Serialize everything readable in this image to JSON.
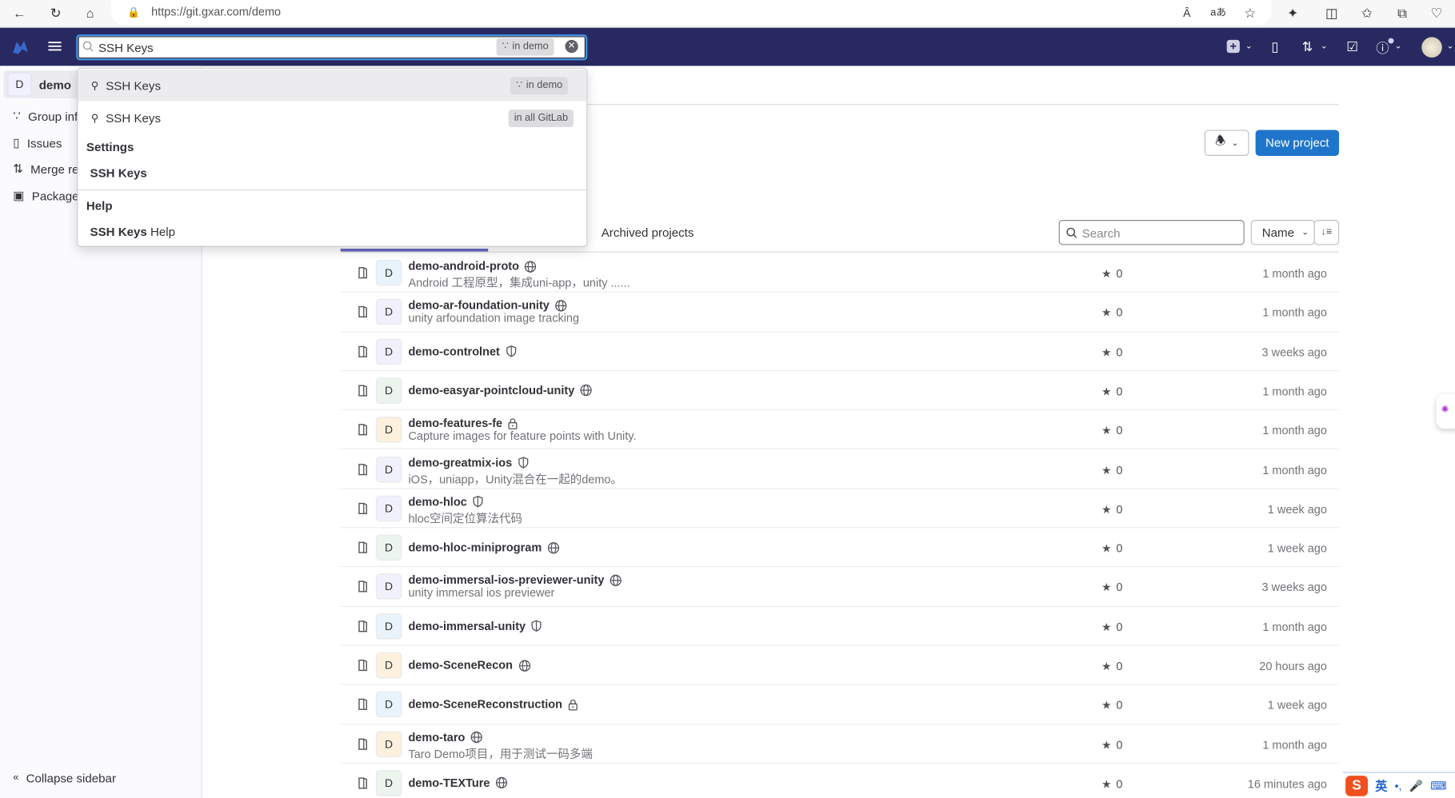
{
  "browser": {
    "url": "https://git.gxar.com/demo",
    "icons": [
      "back-icon",
      "refresh-icon",
      "home-icon",
      "lock-icon",
      "read-aloud-icon",
      "translate-icon",
      "favorite-star-icon",
      "extensions-icon",
      "split-screen-icon",
      "favorites-icon",
      "collections-icon",
      "browser-essentials-icon"
    ]
  },
  "nav": {
    "search_value": "SSH Keys",
    "search_scope": "in demo",
    "colors": {
      "nav_bg": "#292961",
      "primary": "#1f75cb",
      "focus": "#428fdc"
    }
  },
  "dropdown": {
    "items": [
      {
        "label": "SSH Keys",
        "scope": "in demo"
      },
      {
        "label": "SSH Keys",
        "scope": "in all GitLab"
      }
    ],
    "settings_header": "Settings",
    "settings_item": "SSH Keys",
    "help_header": "Help",
    "help_item_bold": "SSH Keys",
    "help_item_rest": " Help"
  },
  "sidebar": {
    "group_avatar": "D",
    "group_name": "demo",
    "items": [
      {
        "label": "Group information",
        "icon": "group-icon"
      },
      {
        "label": "Issues",
        "icon": "issues-icon"
      },
      {
        "label": "Merge requests",
        "icon": "merge-request-icon"
      },
      {
        "label": "Packages and registries",
        "icon": "package-icon"
      }
    ],
    "collapse": "Collapse sidebar"
  },
  "main": {
    "new_project": "New project",
    "tabs": [
      {
        "label": "",
        "active": true
      },
      {
        "label": "Archived projects",
        "active": false
      }
    ],
    "search_placeholder": "Search",
    "sort_label": "Name",
    "projects": [
      {
        "name": "demo-android-proto",
        "visibility": "public",
        "desc": "Android 工程原型，集成uni-app，unity ......",
        "avatar": "D",
        "color": "#e9f3fc",
        "stars": "0",
        "updated": "1 month ago"
      },
      {
        "name": "demo-ar-foundation-unity",
        "visibility": "public",
        "desc": "unity arfoundation image tracking",
        "avatar": "D",
        "color": "#f1f0fd",
        "stars": "0",
        "updated": "1 month ago"
      },
      {
        "name": "demo-controlnet",
        "visibility": "internal",
        "desc": "",
        "avatar": "D",
        "color": "#f1f0fd",
        "stars": "0",
        "updated": "3 weeks ago"
      },
      {
        "name": "demo-easyar-pointcloud-unity",
        "visibility": "public",
        "desc": "",
        "avatar": "D",
        "color": "#ecf4ee",
        "stars": "0",
        "updated": "1 month ago"
      },
      {
        "name": "demo-features-fe",
        "visibility": "private",
        "desc": "Capture images for feature points with Unity.",
        "avatar": "D",
        "color": "#fdf1dd",
        "stars": "0",
        "updated": "1 month ago"
      },
      {
        "name": "demo-greatmix-ios",
        "visibility": "internal",
        "desc": "iOS，uniapp，Unity混合在一起的demo。",
        "avatar": "D",
        "color": "#f1f0fd",
        "stars": "0",
        "updated": "1 month ago"
      },
      {
        "name": "demo-hloc",
        "visibility": "internal",
        "desc": "hloc空间定位算法代码",
        "avatar": "D",
        "color": "#f1f0fd",
        "stars": "0",
        "updated": "1 week ago"
      },
      {
        "name": "demo-hloc-miniprogram",
        "visibility": "public",
        "desc": "",
        "avatar": "D",
        "color": "#ecf4ee",
        "stars": "0",
        "updated": "1 week ago"
      },
      {
        "name": "demo-immersal-ios-previewer-unity",
        "visibility": "public",
        "desc": "unity immersal ios previewer",
        "avatar": "D",
        "color": "#f1f0fd",
        "stars": "0",
        "updated": "3 weeks ago"
      },
      {
        "name": "demo-immersal-unity",
        "visibility": "internal",
        "desc": "",
        "avatar": "D",
        "color": "#e9f3fc",
        "stars": "0",
        "updated": "1 month ago"
      },
      {
        "name": "demo-SceneRecon",
        "visibility": "public",
        "desc": "",
        "avatar": "D",
        "color": "#fdf1dd",
        "stars": "0",
        "updated": "20 hours ago"
      },
      {
        "name": "demo-SceneReconstruction",
        "visibility": "private",
        "desc": "",
        "avatar": "D",
        "color": "#e9f3fc",
        "stars": "0",
        "updated": "1 week ago"
      },
      {
        "name": "demo-taro",
        "visibility": "public",
        "desc": "Taro Demo项目，用于测试一码多端",
        "avatar": "D",
        "color": "#fdf1dd",
        "stars": "0",
        "updated": "1 month ago"
      },
      {
        "name": "demo-TEXTure",
        "visibility": "public",
        "desc": "",
        "avatar": "D",
        "color": "#ecf4ee",
        "stars": "0",
        "updated": "16 minutes ago"
      }
    ]
  },
  "ime": {
    "logo": "S",
    "mode": "英"
  }
}
